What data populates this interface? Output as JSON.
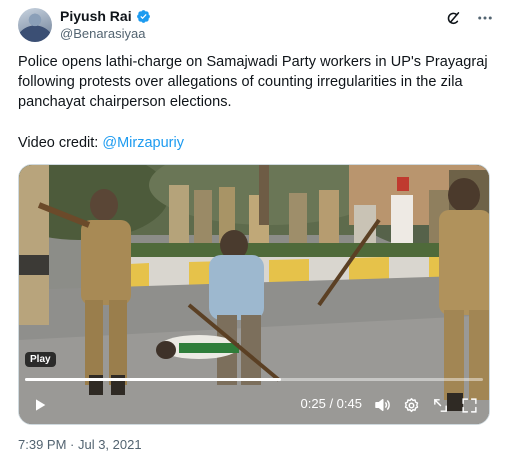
{
  "author": {
    "display_name": "Piyush Rai",
    "handle": "@Benarasiyaa"
  },
  "tweet": {
    "text": "Police opens lathi-charge on Samajwadi Party workers in UP's Prayagraj following protests over allegations of counting irregularities in the zila panchayat chairperson elections.",
    "credit_prefix": "Video credit: ",
    "credit_link": "@Mirzapuriy",
    "timestamp": "7:39 PM · Jul 3, 2021"
  },
  "video": {
    "badge": "Play",
    "time": "0:25 / 0:45",
    "progress": 0.56
  },
  "colors": {
    "link": "#1d9bf0",
    "verified": "#1d9bf0",
    "muted": "#536471"
  },
  "icons": {
    "grok": "grok-icon",
    "more": "more-icon",
    "verified": "verified-badge-icon",
    "play": "play-icon",
    "volume": "volume-icon",
    "settings": "gear-icon",
    "picture_in_picture": "pip-icon",
    "fullscreen": "fullscreen-icon"
  }
}
